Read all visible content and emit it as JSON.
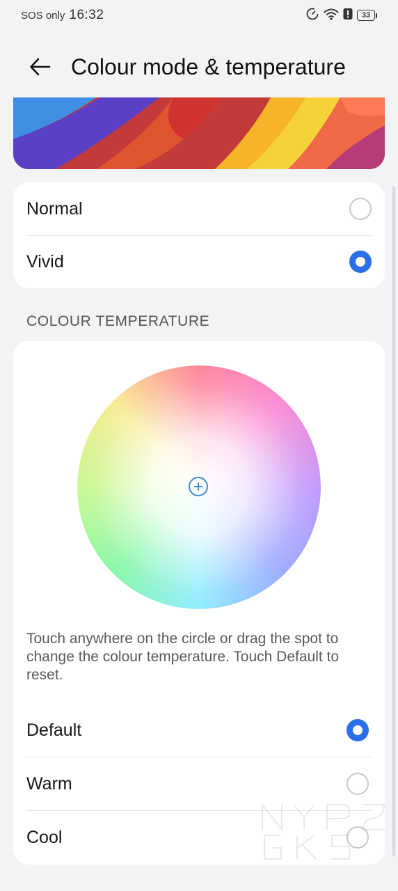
{
  "status_bar": {
    "carrier": "SOS only",
    "time": "16:32",
    "battery": "33",
    "icons": [
      "data-saver-icon",
      "wifi-icon",
      "alert-icon",
      "battery-icon"
    ]
  },
  "header": {
    "title": "Colour mode & temperature",
    "back_icon": "arrow-left-icon"
  },
  "colour_mode": {
    "options": [
      {
        "label": "Normal",
        "selected": false
      },
      {
        "label": "Vivid",
        "selected": true
      }
    ]
  },
  "colour_temperature": {
    "section_title": "COLOUR TEMPERATURE",
    "hint": "Touch anywhere on the circle or drag the spot to change the colour temperature. Touch Default to reset.",
    "options": [
      {
        "label": "Default",
        "selected": true
      },
      {
        "label": "Warm",
        "selected": false
      },
      {
        "label": "Cool",
        "selected": false
      }
    ]
  },
  "colors": {
    "accent": "#2a6ee8",
    "background": "#f1f3f5",
    "card": "#ffffff"
  }
}
